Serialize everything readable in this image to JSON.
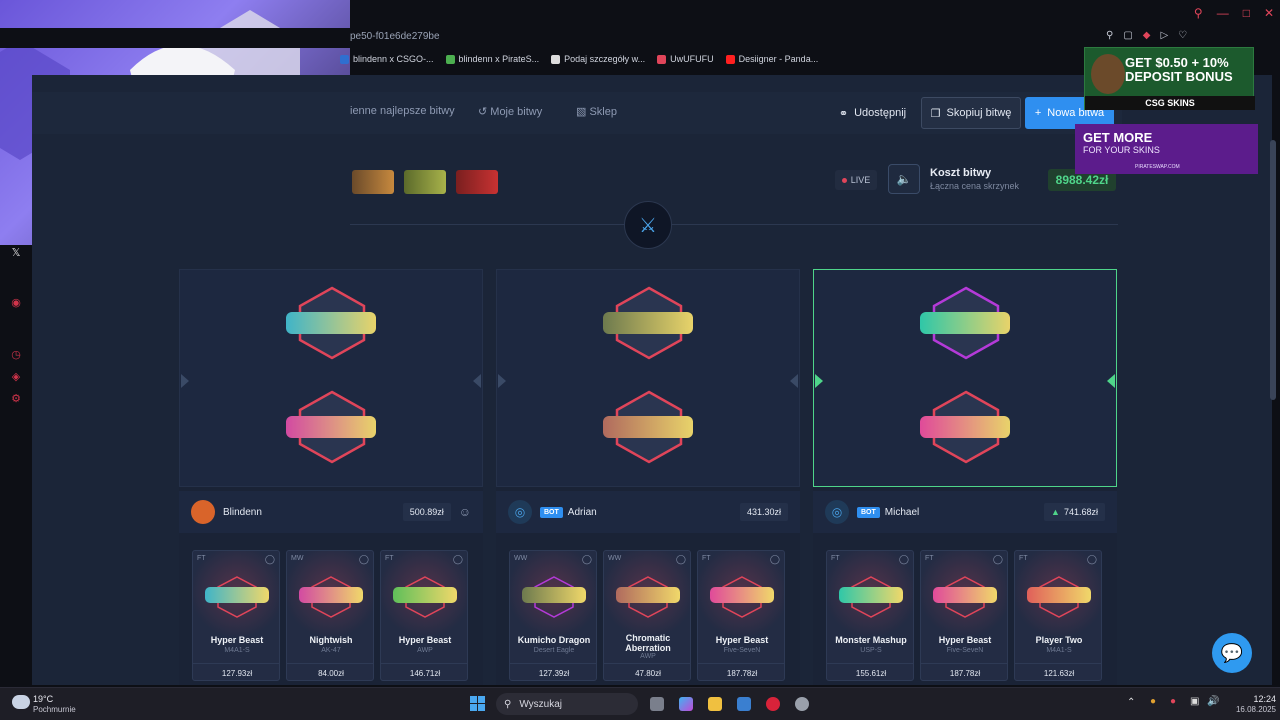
{
  "browser": {
    "url_fragment": "pe50-f01e6de279be",
    "bookmarks": [
      {
        "label": "blindenn x CSGO-...",
        "color": "#2f6fd0"
      },
      {
        "label": "blindenn x PirateS...",
        "color": "#4caf50"
      },
      {
        "label": "Podaj szczegóły w...",
        "color": "#dddddd"
      },
      {
        "label": "UwUFUFU",
        "color": "#e0455a"
      },
      {
        "label": "Desiigner - Panda...",
        "color": "#ff2020"
      }
    ]
  },
  "nav": {
    "best_battles": "ienne najlepsze bitwy",
    "my_battles": "Moje bitwy",
    "shop": "Sklep",
    "share": "Udostępnij",
    "copy": "Skopiuj bitwę",
    "new_battle": "Nowa bitwa"
  },
  "battle": {
    "live_label": "LIVE",
    "cost_title": "Koszt bitwy",
    "cost_subtitle": "Łączna cena skrzynek",
    "cost_value": "8988.42zł"
  },
  "players": [
    {
      "name": "Blindenn",
      "bot": false,
      "value": "500.89zł",
      "avatar_color": "#d9642a",
      "winner": false,
      "items": [
        {
          "cond": "FT",
          "name": "Hyper Beast",
          "type": "M4A1-S",
          "price": "127.93zł",
          "color": "#3fb4c8"
        },
        {
          "cond": "MW",
          "name": "Nightwish",
          "type": "AK-47",
          "price": "84.00zł",
          "color": "#d24aa2"
        },
        {
          "cond": "FT",
          "name": "Hyper Beast",
          "type": "AWP",
          "price": "146.71zł",
          "color": "#5fbf5a"
        }
      ]
    },
    {
      "name": "Adrian",
      "bot": true,
      "bot_label": "BOT",
      "value": "431.30zł",
      "avatar_color": "#1f3a58",
      "winner": false,
      "items": [
        {
          "cond": "WW",
          "name": "Kumicho Dragon",
          "type": "Desert Eagle",
          "price": "127.39zł",
          "color": "#6d7a4e"
        },
        {
          "cond": "WW",
          "name": "Chromatic Aberration",
          "type": "AWP",
          "price": "47.80zł",
          "color": "#b06a5e"
        },
        {
          "cond": "FT",
          "name": "Hyper Beast",
          "type": "Five-SeveN",
          "price": "187.78zł",
          "color": "#e04a9a"
        }
      ]
    },
    {
      "name": "Michael",
      "bot": true,
      "bot_label": "BOT",
      "value": "741.68zł",
      "avatar_color": "#1f3a58",
      "winner": true,
      "items": [
        {
          "cond": "FT",
          "name": "Monster Mashup",
          "type": "USP-S",
          "price": "155.61zł",
          "color": "#2fc7a8"
        },
        {
          "cond": "FT",
          "name": "Hyper Beast",
          "type": "Five-SeveN",
          "price": "187.78zł",
          "color": "#e04a9a"
        },
        {
          "cond": "FT",
          "name": "Player Two",
          "type": "M4A1-S",
          "price": "121.63zł",
          "color": "#e0605a"
        }
      ]
    }
  ],
  "ads": {
    "ad1_line1": "GET $0.50 + 10%",
    "ad1_line2": "DEPOSIT BONUS",
    "ad1_brand": "CSG SKINS",
    "ad2_line1": "GET MORE",
    "ad2_line2": "FOR YOUR SKINS",
    "ad2_brand": "PIRATESWAP.COM"
  },
  "taskbar": {
    "temp": "19°C",
    "weather": "Pochmurnie",
    "search_placeholder": "Wyszukaj",
    "time": "12:24",
    "date": "16.08.2025"
  },
  "colors": {
    "accent": "#2f8ff0",
    "win_green": "#4fd58a",
    "hex_red": "#e0455a",
    "hex_purple": "#b43ad8"
  }
}
